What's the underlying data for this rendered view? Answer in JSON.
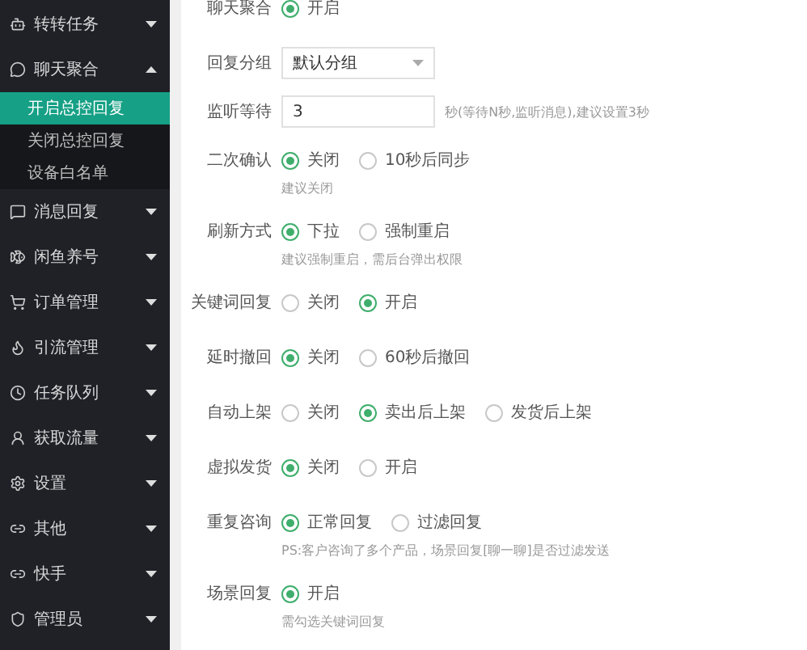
{
  "sidebar": {
    "items": [
      {
        "label": "转转任务",
        "expanded": false
      },
      {
        "label": "聊天聚合",
        "expanded": true,
        "children": [
          {
            "label": "开启总控回复",
            "selected": true
          },
          {
            "label": "关闭总控回复",
            "selected": false
          },
          {
            "label": "设备白名单",
            "selected": false
          }
        ]
      },
      {
        "label": "消息回复",
        "expanded": false
      },
      {
        "label": "闲鱼养号",
        "expanded": false
      },
      {
        "label": "订单管理",
        "expanded": false
      },
      {
        "label": "引流管理",
        "expanded": false
      },
      {
        "label": "任务队列",
        "expanded": false
      },
      {
        "label": "获取流量",
        "expanded": false
      },
      {
        "label": "设置",
        "expanded": false
      },
      {
        "label": "其他",
        "expanded": false
      },
      {
        "label": "快手",
        "expanded": false
      },
      {
        "label": "管理员",
        "expanded": false
      }
    ]
  },
  "form": {
    "rows": [
      {
        "label": "聊天聚合",
        "kind": "radio",
        "options": [
          {
            "label": "开启",
            "selected": true
          }
        ]
      },
      {
        "label": "回复分组",
        "kind": "select",
        "value": "默认分组"
      },
      {
        "label": "监听等待",
        "kind": "input",
        "value": "3",
        "suffix": "秒(等待N秒,监听消息),建议设置3秒"
      },
      {
        "label": "二次确认",
        "kind": "radio",
        "options": [
          {
            "label": "关闭",
            "selected": true
          },
          {
            "label": "10秒后同步",
            "selected": false
          }
        ],
        "hint": "建议关闭"
      },
      {
        "label": "刷新方式",
        "kind": "radio",
        "options": [
          {
            "label": "下拉",
            "selected": true
          },
          {
            "label": "强制重启",
            "selected": false
          }
        ],
        "hint": "建议强制重启，需后台弹出权限"
      },
      {
        "label": "关键词回复",
        "kind": "radio",
        "options": [
          {
            "label": "关闭",
            "selected": false
          },
          {
            "label": "开启",
            "selected": true
          }
        ]
      },
      {
        "label": "延时撤回",
        "kind": "radio",
        "options": [
          {
            "label": "关闭",
            "selected": true
          },
          {
            "label": "60秒后撤回",
            "selected": false
          }
        ]
      },
      {
        "label": "自动上架",
        "kind": "radio",
        "options": [
          {
            "label": "关闭",
            "selected": false
          },
          {
            "label": "卖出后上架",
            "selected": true
          },
          {
            "label": "发货后上架",
            "selected": false
          }
        ]
      },
      {
        "label": "虚拟发货",
        "kind": "radio",
        "options": [
          {
            "label": "关闭",
            "selected": true
          },
          {
            "label": "开启",
            "selected": false
          }
        ]
      },
      {
        "label": "重复咨询",
        "kind": "radio",
        "options": [
          {
            "label": "正常回复",
            "selected": true
          },
          {
            "label": "过滤回复",
            "selected": false
          }
        ],
        "hint": "PS:客户咨询了多个产品，场景回复[聊一聊]是否过滤发送"
      },
      {
        "label": "场景回复",
        "kind": "radio",
        "options": [
          {
            "label": "开启",
            "selected": true
          }
        ],
        "hint": "需勾选关键词回复"
      }
    ]
  }
}
